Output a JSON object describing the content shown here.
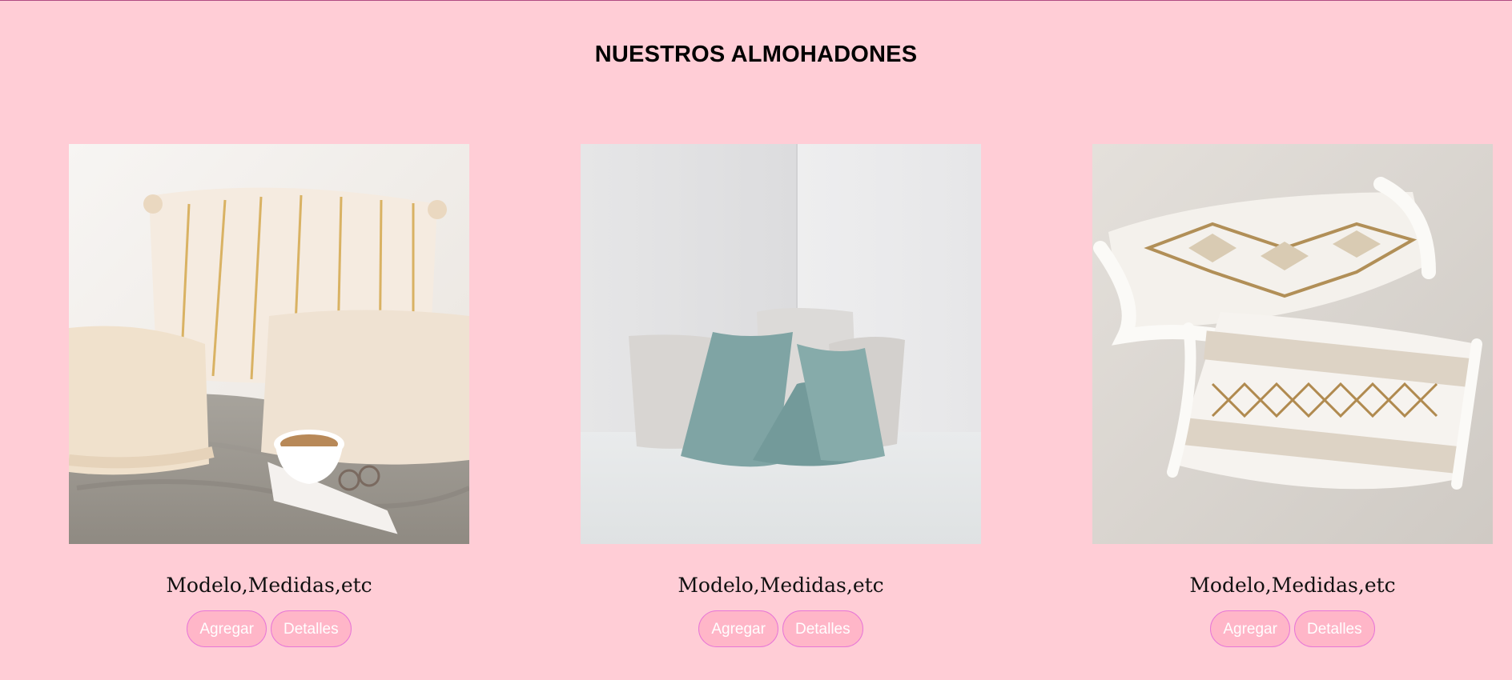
{
  "page": {
    "title": "NUESTROS ALMOHADONES",
    "background_color": "#ffcdd6"
  },
  "products": [
    {
      "image_icon": "cream-striped-pillows-photo",
      "name": "Modelo,Medidas,etc",
      "add_label": "Agregar",
      "details_label": "Detalles"
    },
    {
      "image_icon": "teal-corner-pillows-photo",
      "name": "Modelo,Medidas,etc",
      "add_label": "Agregar",
      "details_label": "Detalles"
    },
    {
      "image_icon": "fringed-boho-pillows-photo",
      "name": "Modelo,Medidas,etc",
      "add_label": "Agregar",
      "details_label": "Detalles"
    }
  ],
  "colors": {
    "button_bg": "#ffb6c8",
    "button_border": "#e876d7",
    "button_text": "#ffffff"
  }
}
